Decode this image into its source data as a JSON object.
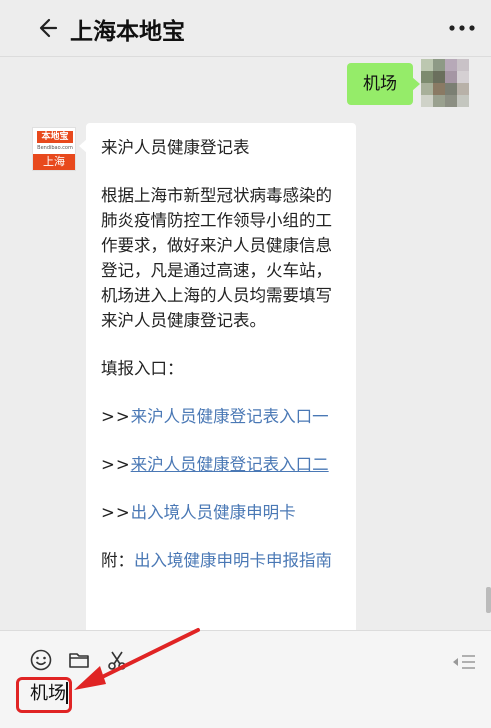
{
  "header": {
    "title": "上海本地宝"
  },
  "messages": {
    "sent": {
      "text": "机场"
    },
    "account": {
      "logo_top": "本地宝",
      "logo_middle": "Bendibao.com",
      "logo_bottom": "上海"
    },
    "article": {
      "heading": "来沪人员健康登记表",
      "body": "根据上海市新型冠状病毒感染的肺炎疫情防控工作领导小组的工作要求，做好来沪人员健康信息登记，凡是通过高速，火车站，机场进入上海的人员均需要填写来沪人员健康登记表。",
      "entry_label": "填报入口：",
      "prefix": ">>",
      "link1": "来沪人员健康登记表入口一",
      "link2": "来沪人员健康登记表入口二",
      "link3": "出入境人员健康申明卡",
      "note_label": "附：",
      "note_link": "出入境健康申明卡申报指南"
    }
  },
  "input": {
    "value": "机场"
  },
  "colors": {
    "sent_bubble": "#95ec69",
    "link": "#4a78b5",
    "annotation": "#e02424",
    "logo": "#e8491d"
  },
  "icons": [
    "back-arrow-icon",
    "more-dots-icon",
    "emoji-icon",
    "folder-icon",
    "scissors-icon",
    "send-list-icon"
  ]
}
